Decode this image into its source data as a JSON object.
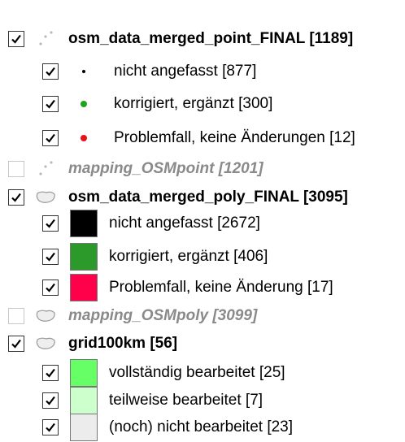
{
  "legend": {
    "layers": [
      {
        "label": "osm_data_merged_point_FINAL [1189]",
        "checked": true,
        "icon": "point-layer-icon"
      },
      {
        "label": "nicht angefasst [877]",
        "checked": true,
        "symbol": "dot",
        "color": "#000000"
      },
      {
        "label": "korrigiert, ergänzt [300]",
        "checked": true,
        "symbol": "dot",
        "color": "#1fa31f"
      },
      {
        "label": "Problemfall, keine Änderungen [12]",
        "checked": true,
        "symbol": "dot",
        "color": "#e8101a"
      },
      {
        "label": "mapping_OSMpoint [1201]",
        "checked": false,
        "icon": "point-layer-icon"
      },
      {
        "label": "osm_data_merged_poly_FINAL [3095]",
        "checked": true,
        "icon": "polygon-layer-icon"
      },
      {
        "label": "nicht angefasst [2672]",
        "checked": true,
        "symbol": "square",
        "color": "#000000"
      },
      {
        "label": "korrigiert, ergänzt [406]",
        "checked": true,
        "symbol": "square",
        "color": "#2b9a2b"
      },
      {
        "label": "Problemfall, keine Änderung [17]",
        "checked": true,
        "symbol": "square",
        "color": "#ff004a"
      },
      {
        "label": "mapping_OSMpoly [3099]",
        "checked": false,
        "icon": "polygon-layer-icon"
      },
      {
        "label": "grid100km [56]",
        "checked": true,
        "icon": "polygon-layer-icon"
      },
      {
        "label": "vollständig bearbeitet [25]",
        "checked": true,
        "symbol": "square",
        "color": "#66ff66"
      },
      {
        "label": "teilweise bearbeitet [7]",
        "checked": true,
        "symbol": "square",
        "color": "#ccffcc"
      },
      {
        "label": "(noch) nicht bearbeitet [23]",
        "checked": true,
        "symbol": "square",
        "color": "#ececec"
      }
    ]
  }
}
